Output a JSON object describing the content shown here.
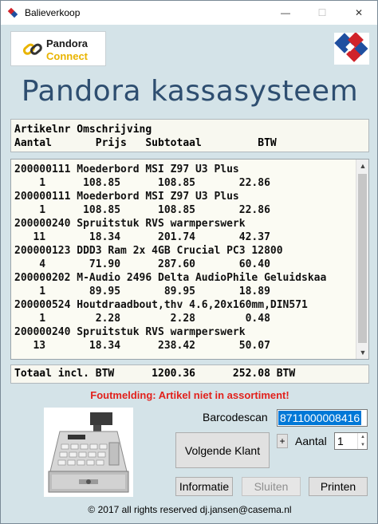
{
  "window": {
    "title": "Balieverkoop",
    "minimize": "—",
    "maximize": "☐",
    "close": "✕"
  },
  "logo": {
    "line1": "Pandora",
    "line2": "Connect"
  },
  "main_title": "Pandora kassasysteem",
  "header": {
    "line1": "Artikelnr Omschrijving",
    "line2": "Aantal       Prijs   Subtotaal         BTW"
  },
  "items": [
    {
      "line1": "200000111 Moederbord MSI Z97 U3 Plus",
      "line2": "    1      108.85      108.85       22.86"
    },
    {
      "line1": "200000111 Moederbord MSI Z97 U3 Plus",
      "line2": "    1      108.85      108.85       22.86"
    },
    {
      "line1": "200000240 Spruitstuk RVS warmperswerk",
      "line2": "   11       18.34      201.74       42.37"
    },
    {
      "line1": "200000123 DDD3 Ram 2x 4GB Crucial PC3 12800",
      "line2": "    4       71.90      287.60       60.40"
    },
    {
      "line1": "200000202 M-Audio 2496 Delta AudioPhile Geluidskaa",
      "line2": "    1       89.95       89.95       18.89"
    },
    {
      "line1": "200000524 Houtdraadbout,thv 4.6,20x160mm,DIN571",
      "line2": "    1        2.28        2.28        0.48"
    },
    {
      "line1": "200000240 Spruitstuk RVS warmperswerk",
      "line2": "   13       18.34      238.42       50.07"
    }
  ],
  "total_line": "Totaal incl. BTW      1200.36      252.08 BTW",
  "error_message": "Foutmelding: Artikel niet in assortiment!",
  "barcode": {
    "label": "Barcodescan",
    "value": "8711000008416"
  },
  "buttons": {
    "next_customer": "Volgende Klant",
    "plus": "+",
    "info": "Informatie",
    "close": "Sluiten",
    "print": "Printen"
  },
  "quantity": {
    "label": "Aantal",
    "value": "1"
  },
  "footer": "© 2017 all rights reserved dj.jansen@casema.nl",
  "colors": {
    "background": "#d4e3e8",
    "title": "#2e4e70",
    "error": "#e2211c",
    "selection": "#0078d7"
  }
}
